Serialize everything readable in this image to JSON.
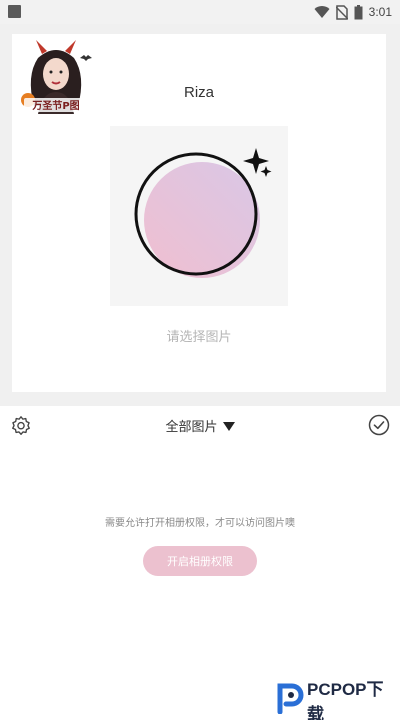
{
  "status_bar": {
    "time": "3:01",
    "icons": [
      "wifi-icon",
      "no-sim-icon",
      "battery-icon"
    ]
  },
  "editor": {
    "avatar_caption": "万圣节P图",
    "nickname": "Riza",
    "choose_hint": "请选择图片",
    "icons": [
      "sparkle-icon"
    ]
  },
  "toolbar": {
    "album_label": "全部图片",
    "icons": [
      "settings-icon",
      "dropdown-triangle-icon",
      "check-circle-icon"
    ]
  },
  "permission": {
    "message": "需要允许打开相册权限，才可以访问图片噢",
    "button_label": "开启相册权限"
  },
  "watermark": {
    "text": "PCPOP下载"
  },
  "colors": {
    "accent_pink": "#ecc1cf",
    "panel_bg": "#f0f0f0"
  }
}
